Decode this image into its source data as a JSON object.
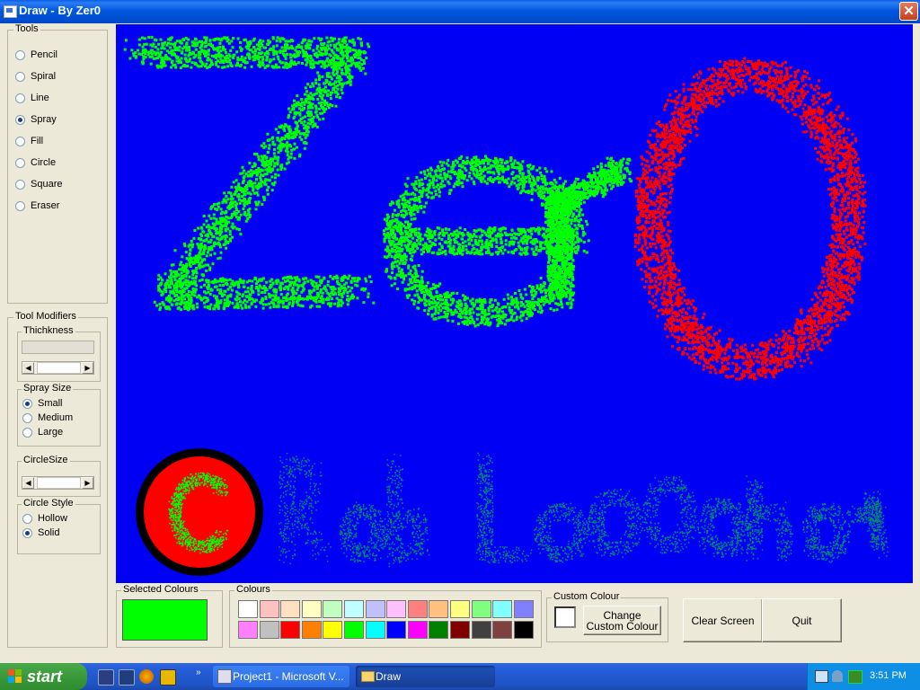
{
  "window": {
    "title": "Draw - By Zer0"
  },
  "tools": {
    "title": "Tools",
    "items": [
      {
        "label": "Pencil",
        "checked": false
      },
      {
        "label": "Spiral",
        "checked": false
      },
      {
        "label": "Line",
        "checked": false
      },
      {
        "label": "Spray",
        "checked": true
      },
      {
        "label": "Fill",
        "checked": false
      },
      {
        "label": "Circle",
        "checked": false
      },
      {
        "label": "Square",
        "checked": false
      },
      {
        "label": "Eraser",
        "checked": false
      }
    ]
  },
  "modifiers": {
    "title": "Tool Modifiers",
    "thickness": {
      "title": "Thichkness"
    },
    "spray_size": {
      "title": "Spray Size",
      "options": [
        {
          "label": "Small",
          "checked": true
        },
        {
          "label": "Medium",
          "checked": false
        },
        {
          "label": "Large",
          "checked": false
        }
      ]
    },
    "circle_size": {
      "title": "CircleSize"
    },
    "circle_style": {
      "title": "Circle Style",
      "options": [
        {
          "label": "Hollow",
          "checked": false
        },
        {
          "label": "Solid",
          "checked": true
        }
      ]
    }
  },
  "selected_colours": {
    "title": "Selected Colours",
    "color": "#00ff00"
  },
  "colours": {
    "title": "Colours",
    "palette": [
      "#ffffff",
      "#ffc0c0",
      "#ffe0c0",
      "#ffffc0",
      "#c0ffc0",
      "#c0ffff",
      "#c0c0ff",
      "#ffc0ff",
      "#ff8080",
      "#ffc080",
      "#ffff80",
      "#80ff80",
      "#80ffff",
      "#8080ff",
      "#ff80ff",
      "#c0c0c0",
      "#ff0000",
      "#ff8000",
      "#ffff00",
      "#00ff00",
      "#00ffff",
      "#0000ff",
      "#ff00ff",
      "#008000",
      "#800000",
      "#404040",
      "#804040",
      "#000000"
    ]
  },
  "custom_colour": {
    "title": "Custom Colour",
    "button_label": "Change Custom Colour",
    "color": "#ffffff"
  },
  "buttons": {
    "clear": "Clear Screen",
    "quit": "Quit"
  },
  "canvas": {
    "background": "#0000f5",
    "text": "Zer0",
    "faded_text": "Rob Lambeth",
    "badge_letter": "C",
    "colors": {
      "green": "#00ff00",
      "red": "#ff0000",
      "black": "#000000"
    }
  },
  "taskbar": {
    "start": "start",
    "tasks": [
      {
        "label": "Project1 - Microsoft V..."
      },
      {
        "label": "Draw"
      }
    ],
    "clock": "3:51 PM"
  }
}
